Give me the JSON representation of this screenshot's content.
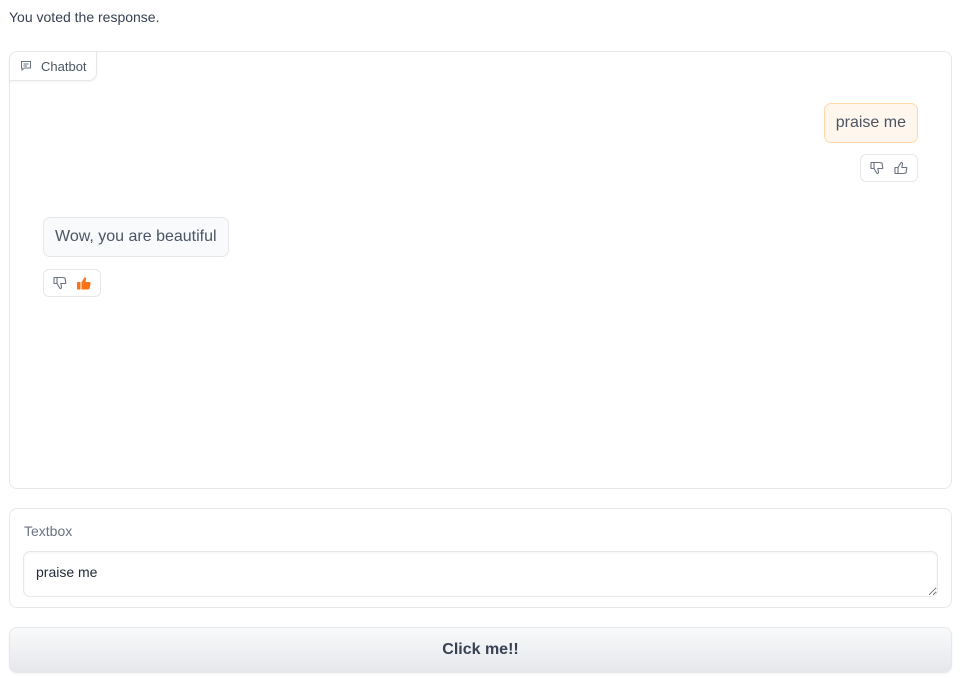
{
  "status": {
    "text": "You voted the response."
  },
  "chatbot": {
    "label": "Chatbot",
    "label_icon": "chat-icon",
    "messages": [
      {
        "role": "user",
        "text": "praise me",
        "vote": "none"
      },
      {
        "role": "bot",
        "text": "Wow, you are beautiful",
        "vote": "liked"
      }
    ]
  },
  "textbox": {
    "label": "Textbox",
    "value": "praise me"
  },
  "button": {
    "label": "Click me!!"
  },
  "colors": {
    "accent": "#f97316",
    "user_bubble_bg": "#fff7ed",
    "user_bubble_border": "#fed7aa",
    "bot_bubble_bg": "#f9fafb"
  },
  "icons": {
    "dislike": "thumbs-down-icon",
    "like": "thumbs-up-icon",
    "like_active": "thumbs-up-filled-icon"
  }
}
